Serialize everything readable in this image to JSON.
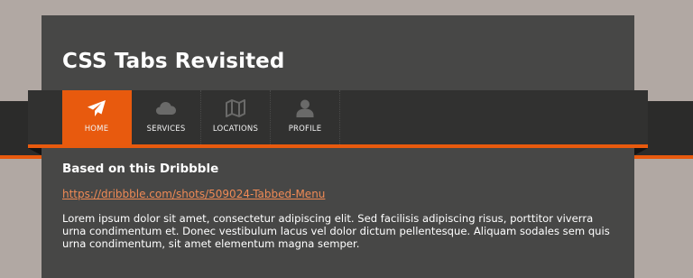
{
  "page": {
    "title": "CSS Tabs Revisited"
  },
  "tabs": [
    {
      "label": "HOME",
      "icon": "paper-plane-icon",
      "active": true
    },
    {
      "label": "SERVICES",
      "icon": "cloud-icon",
      "active": false
    },
    {
      "label": "LOCATIONS",
      "icon": "map-icon",
      "active": false
    },
    {
      "label": "PROFILE",
      "icon": "user-icon",
      "active": false
    }
  ],
  "content": {
    "heading": "Based on this Dribbble",
    "link": "https://dribbble.com/shots/509024-Tabbed-Menu",
    "body": "Lorem ipsum dolor sit amet, consectetur adipiscing elit. Sed facilisis adipiscing risus, porttitor viverra urna condimentum et. Donec vestibulum lacus vel dolor dictum pellentesque. Aliquam sodales sem quis urna condimentum, sit amet elementum magna semper."
  },
  "colors": {
    "accent": "#e85a0e",
    "background": "#b1a8a3",
    "card": "#474746",
    "nav": "#313130",
    "icon_inactive": "#6a6a69",
    "link": "#f08a55"
  }
}
